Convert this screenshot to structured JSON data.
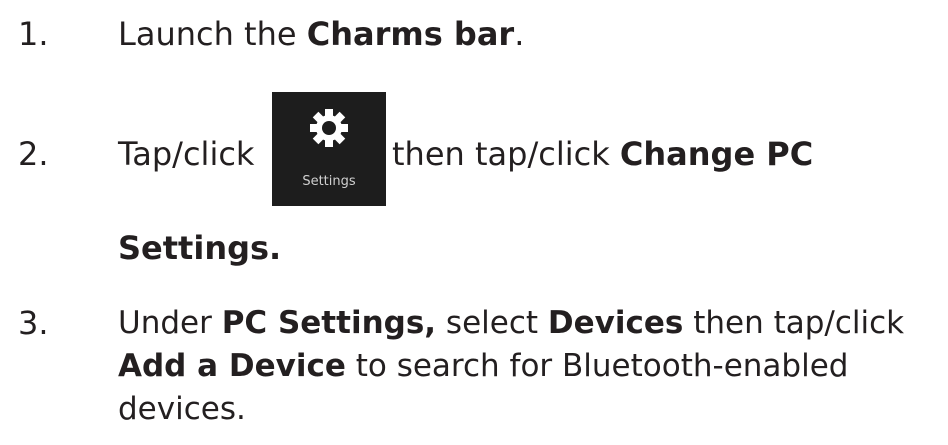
{
  "steps": [
    {
      "number": "1.",
      "parts": [
        "Launch the ",
        "Charms bar",
        "."
      ]
    },
    {
      "number": "2.",
      "parts": [
        "Tap/click ",
        " then tap/click ",
        "Change PC",
        "Settings."
      ],
      "tile": {
        "label": "Settings",
        "icon": "gear-icon"
      }
    },
    {
      "number": "3.",
      "parts": [
        "Under ",
        "PC Settings,",
        " select ",
        "Devices",
        " then tap/click",
        "Add a Device",
        " to search for Bluetooth-enabled",
        "devices."
      ]
    }
  ]
}
